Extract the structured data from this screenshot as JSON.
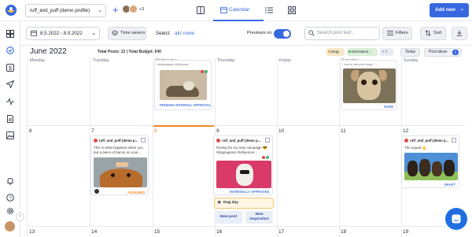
{
  "app": {
    "profile_name": "ruff_and_puff (demo profile)",
    "extra_members": "+3",
    "nav_calendar": "Calendar",
    "add_new": "Add new",
    "add_new_chevron": "⌄"
  },
  "toolbar": {
    "date_range": "8.5.2022 - 8.9.2022",
    "time_savers": "Time savers",
    "select_label": "Select:",
    "select_all": "all",
    "select_sep": "/",
    "select_none": "none",
    "previews_label": "Previews on",
    "search_placeholder": "Search post text...",
    "filters": "Filters",
    "sort": "Sort"
  },
  "infobar": {
    "month": "June 2022",
    "total_posts": "Total Posts: 13 | Total Budget: €40",
    "tags": [
      {
        "label": "Dogs",
        "color": "#f6e7c8"
      },
      {
        "label": "Entertainm...",
        "color": "#dcefd8"
      },
      {
        "label": "+ 7",
        "color": "#e8ebf2"
      }
    ],
    "today": "Today",
    "post_ideas": "Post ideas",
    "post_ideas_count": "1"
  },
  "calendar": {
    "days": [
      "Monday",
      "Tuesday",
      "Wednesday",
      "Thursday",
      "Friday",
      "Saturday",
      "Sunday"
    ],
    "week2_dates": [
      "6",
      "7",
      "8",
      "9",
      "10",
      "11",
      "12"
    ],
    "week3_dates": [
      "13",
      "14",
      "15",
      "16",
      "17",
      "18",
      "19"
    ],
    "today_color": "#f08a24"
  },
  "cards": {
    "wed_top": {
      "status": "PENDING INTERNAL APPROVAL",
      "caption": "#dognagram #influence"
    },
    "sun_top": {
      "status": "DONE",
      "caption": "how is that even legal..."
    },
    "tue": {
      "account": "ruff_and_puff (demo p...",
      "text": "This is what happens when you put a piece of bacon on your...",
      "status": "ASSIGNED"
    },
    "thu": {
      "account": "ruff_and_puff (demo p...",
      "text": "Posing for my new campaign 😎 #dognagram #influencer...",
      "status": "INTERNALLY APPROVED"
    },
    "sun": {
      "account": "ruff_and_puff (demo p...",
      "text": "The squad 💪",
      "status": "DRAFT"
    },
    "dog_day": "Dog day",
    "new_post": "New post",
    "new_inspiration": "New inspiration"
  },
  "colors": {
    "accent": "#3768e0",
    "pending": "#4a7bd6",
    "done": "#4a7bd6",
    "assigned": "#f08a24",
    "approved": "#4a7bd6"
  },
  "icons": [
    "logo-icon",
    "plus-icon",
    "columns-icon",
    "calendar-icon",
    "list-icon",
    "grid-icon",
    "dashboard-icon",
    "check-circle-icon",
    "dollar-icon",
    "send-icon",
    "activity-icon",
    "document-icon",
    "image-icon",
    "bell-icon",
    "help-icon",
    "settings-icon",
    "search-icon",
    "filter-icon",
    "sort-icon",
    "download-icon",
    "chat-icon"
  ]
}
